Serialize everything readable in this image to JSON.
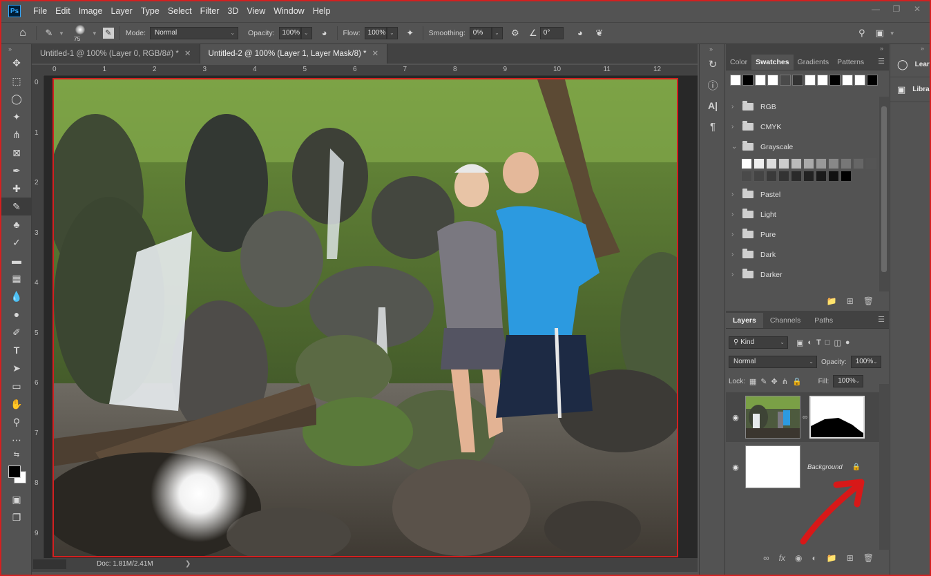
{
  "menubar": {
    "logo": "Ps",
    "items": [
      "File",
      "Edit",
      "Image",
      "Layer",
      "Type",
      "Select",
      "Filter",
      "3D",
      "View",
      "Window",
      "Help"
    ]
  },
  "options": {
    "brush_size": "75",
    "mode_label": "Mode:",
    "mode_value": "Normal",
    "opacity_label": "Opacity:",
    "opacity_value": "100%",
    "flow_label": "Flow:",
    "flow_value": "100%",
    "smoothing_label": "Smoothing:",
    "smoothing_value": "0%",
    "angle_value": "0°"
  },
  "tabs": [
    {
      "label": "Untitled-1 @ 100% (Layer 0, RGB/8#) *",
      "active": false
    },
    {
      "label": "Untitled-2 @ 100% (Layer 1, Layer Mask/8) *",
      "active": true
    }
  ],
  "ruler": {
    "h": [
      "0",
      "1",
      "2",
      "3",
      "4",
      "5",
      "6",
      "7",
      "8",
      "9",
      "10",
      "11",
      "12"
    ],
    "v": [
      "0",
      "1",
      "2",
      "3",
      "4",
      "5",
      "6",
      "7",
      "8",
      "9"
    ]
  },
  "status": {
    "doc": "Doc: 1.81M/2.41M",
    "caret": "❯"
  },
  "swatches_panel": {
    "tabs": [
      "Color",
      "Swatches",
      "Gradients",
      "Patterns"
    ],
    "active_tab": "Swatches",
    "recent": [
      "#ffffff",
      "#000000",
      "#ffffff",
      "#ffffff",
      "#4a4a4a",
      "#333333",
      "#ffffff",
      "#ffffff",
      "#000000",
      "#ffffff",
      "#ffffff",
      "#000000"
    ],
    "groups": [
      "RGB",
      "CMYK",
      "Grayscale",
      "Pastel",
      "Light",
      "Pure",
      "Dark",
      "Darker"
    ],
    "grayscale": [
      "#ffffff",
      "#eeeeee",
      "#dddddd",
      "#cccccc",
      "#bbbbbb",
      "#aaaaaa",
      "#999999",
      "#888888",
      "#777777",
      "#666666",
      "#555555",
      "#4a4a4a",
      "#444444",
      "#3a3a3a",
      "#333333",
      "#2a2a2a",
      "#222222",
      "#1a1a1a",
      "#111111",
      "#000000"
    ]
  },
  "layers_panel": {
    "tabs": [
      "Layers",
      "Channels",
      "Paths"
    ],
    "active_tab": "Layers",
    "filter_kind": "Kind",
    "blend_mode": "Normal",
    "opacity_label": "Opacity:",
    "opacity_value": "100%",
    "lock_label": "Lock:",
    "fill_label": "Fill:",
    "fill_value": "100%",
    "layers": [
      {
        "name": "",
        "has_mask": true,
        "selected": true
      },
      {
        "name": "Background",
        "locked": true,
        "selected": false
      }
    ]
  },
  "learn_panel": {
    "items": [
      "Learn",
      "Libraries"
    ]
  },
  "colors": {
    "accent_red": "#d42020",
    "panel": "#535353",
    "dark": "#424242"
  }
}
